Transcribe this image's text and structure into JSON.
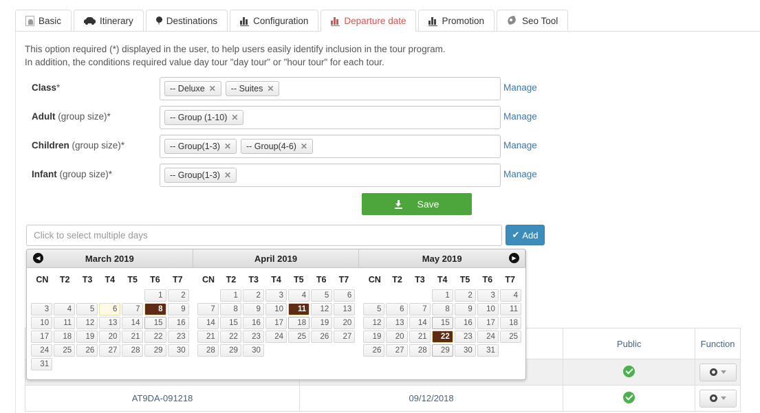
{
  "tabs": [
    {
      "label": "Basic",
      "icon": "document-user-icon",
      "active": false
    },
    {
      "label": "Itinerary",
      "icon": "car-icon",
      "active": false
    },
    {
      "label": "Destinations",
      "icon": "map-pin-icon",
      "active": false
    },
    {
      "label": "Configuration",
      "icon": "bar-chart-icon",
      "active": false
    },
    {
      "label": "Departure date",
      "icon": "bar-chart-icon",
      "active": true
    },
    {
      "label": "Promotion",
      "icon": "bar-chart-icon",
      "active": false
    },
    {
      "label": "Seo Tool",
      "icon": "seo-icon",
      "active": false
    }
  ],
  "intro": {
    "line1": "This option required (*) displayed in the user, to help users easily identify inclusion in the tour program.",
    "line2": "In addition, the conditions required value day tour \"day tour\" or \"hour tour\" for each tour."
  },
  "form": {
    "manage_label": "Manage",
    "rows": [
      {
        "label_strong": "Class",
        "label_rest": "*",
        "chips": [
          "-- Deluxe",
          "-- Suites"
        ]
      },
      {
        "label_strong": "Adult",
        "label_rest": " (group size)*",
        "chips": [
          "-- Group (1-10)"
        ]
      },
      {
        "label_strong": "Children",
        "label_rest": " (group size)*",
        "chips": [
          "-- Group(1-3)",
          "-- Group(4-6)"
        ]
      },
      {
        "label_strong": "Infant",
        "label_rest": " (group size)*",
        "chips": [
          "-- Group(1-3)"
        ]
      }
    ],
    "save_label": "Save"
  },
  "datepicker": {
    "input_placeholder": "Click to select multiple days",
    "input_value": "",
    "add_label": "Add",
    "prev_arrow": "◀",
    "next_arrow": "▶",
    "dow": [
      "CN",
      "T2",
      "T3",
      "T4",
      "T5",
      "T6",
      "T7"
    ],
    "months": [
      {
        "title": "March 2019",
        "lead_blanks": 5,
        "days": 31,
        "selected": [
          8
        ],
        "hovered": [
          6
        ],
        "outlined": [
          15
        ]
      },
      {
        "title": "April 2019",
        "lead_blanks": 1,
        "days": 30,
        "selected": [
          11
        ],
        "hovered": [],
        "outlined": [
          18
        ]
      },
      {
        "title": "May 2019",
        "lead_blanks": 3,
        "days": 31,
        "selected": [
          22
        ],
        "hovered": [],
        "outlined": [
          15,
          29
        ]
      }
    ]
  },
  "table": {
    "headers": [
      "",
      "",
      "Public",
      "Function"
    ],
    "rows": [
      {
        "code": "",
        "date": "",
        "public": "check-icon",
        "function": "gear-dropdown",
        "alt": true
      },
      {
        "code": "AT9DA-091218",
        "date": "09/12/2018",
        "public": "check-icon",
        "function": "gear-dropdown",
        "alt": false
      }
    ]
  },
  "colors": {
    "accent_red": "#d9534f",
    "link_blue": "#337ab7",
    "save_green": "#4ca63c",
    "add_blue": "#3c8dbc",
    "selected_day": "#5f2a16",
    "check_green": "#4caf50"
  }
}
